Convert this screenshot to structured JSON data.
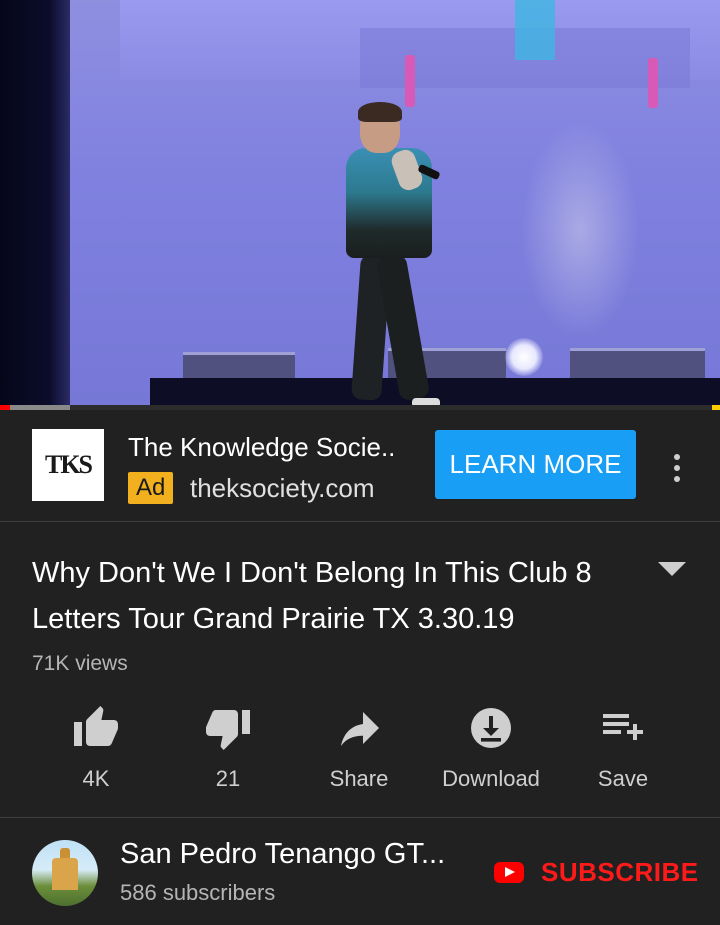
{
  "video": {
    "progress_played_fraction": 0.014,
    "progress_buffered_fraction": 0.097
  },
  "ad": {
    "logo_text": "TKS",
    "title": "The Knowledge Socie..",
    "badge": "Ad",
    "domain": "theksociety.com",
    "cta_label": "LEARN MORE",
    "colors": {
      "cta": "#189ff5",
      "badge": "#f2b01e"
    }
  },
  "video_info": {
    "title": "Why Don't We I Don't Belong In This Club 8 Letters Tour Grand Prairie TX 3.30.19",
    "views": "71K views"
  },
  "actions": [
    {
      "icon": "thumbs-up-icon",
      "label": "4K"
    },
    {
      "icon": "thumbs-down-icon",
      "label": "21"
    },
    {
      "icon": "share-icon",
      "label": "Share"
    },
    {
      "icon": "download-icon",
      "label": "Download"
    },
    {
      "icon": "playlist-add-icon",
      "label": "Save"
    }
  ],
  "channel": {
    "name": "San Pedro Tenango GT...",
    "subscribers": "586 subscribers",
    "subscribe_label": "SUBSCRIBE",
    "colors": {
      "subscribe": "#ff1a1a"
    }
  }
}
